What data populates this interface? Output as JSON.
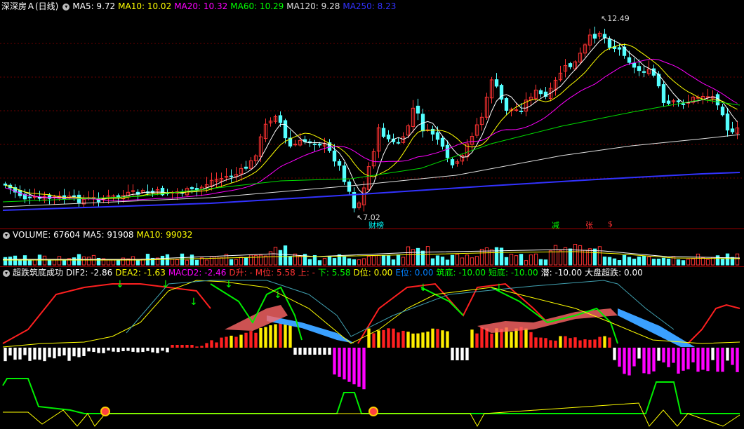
{
  "colors": {
    "up": "#ff3232",
    "down": "#54ffff",
    "bg": "#000000",
    "grid": "#7a0000"
  },
  "price_panel": {
    "title": "深深房Ａ(日线)",
    "collapse_icon": "circle-down-icon",
    "ma": [
      {
        "label": "MA5: 9.72",
        "color": "#ffffff"
      },
      {
        "label": "MA10: 10.02",
        "color": "#ffff00"
      },
      {
        "label": "MA20: 10.32",
        "color": "#ff00ff"
      },
      {
        "label": "MA60: 10.29",
        "color": "#00ff00"
      },
      {
        "label": "MA120: 9.28",
        "color": "#e0e0e0"
      },
      {
        "label": "MA250: 8.23",
        "color": "#3232ff"
      }
    ],
    "high_marker": "12.49",
    "low_marker": "7.02",
    "events": [
      {
        "label": "财榜",
        "color": "#00ffff"
      },
      {
        "label": "减",
        "color": "#00ff00"
      },
      {
        "label": "张",
        "color": "#ff3232"
      },
      {
        "label": "$",
        "color": "#ff3232"
      }
    ]
  },
  "volume_panel": {
    "items": [
      {
        "label": "VOLUME: 67604",
        "color": "#ffffff"
      },
      {
        "label": "MA5: 91908",
        "color": "#ffffff"
      },
      {
        "label": "MA10: 99032",
        "color": "#ffff00"
      }
    ]
  },
  "indicator_panel": {
    "title": "超跌筑底成功",
    "items": [
      {
        "label": "DIF2: -2.86",
        "color": "#ffffff"
      },
      {
        "label": "DEA2: -1.63",
        "color": "#ffff00"
      },
      {
        "label": "MACD2: -2.46",
        "color": "#ff00ff"
      },
      {
        "label": "D升: -",
        "color": "#ff3232"
      },
      {
        "label": "M位: 5.58",
        "color": "#ff3232"
      },
      {
        "label": "上: -",
        "color": "#ff3232"
      },
      {
        "label": "下: 5.58",
        "color": "#00ff00"
      },
      {
        "label": "D位: 0.00",
        "color": "#ffff00"
      },
      {
        "label": "E位: 0.00",
        "color": "#0080ff"
      },
      {
        "label": "筑底: -10.00",
        "color": "#00ff00"
      },
      {
        "label": "短底: -10.00",
        "color": "#00ff00"
      },
      {
        "label": "潜: -10.00",
        "color": "#ffffff"
      },
      {
        "label": "大盘超跌: 0.00",
        "color": "#ffffff"
      }
    ]
  }
}
